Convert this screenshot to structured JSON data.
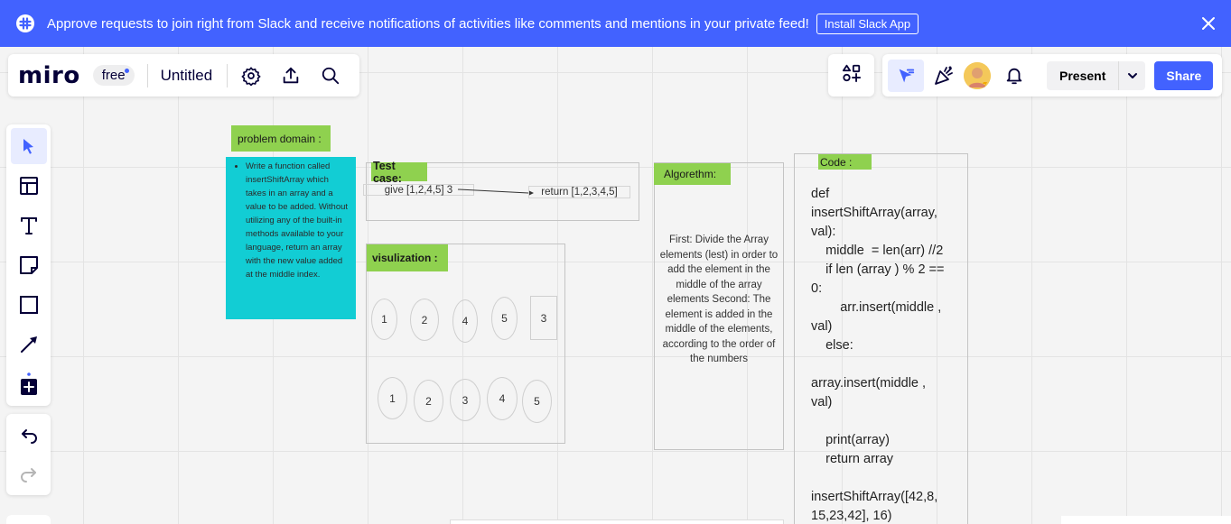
{
  "banner": {
    "message": "Approve requests to join right from Slack and receive notifications of activities like comments and mentions in your private feed!",
    "install_label": "Install Slack App",
    "bg_color": "#4262ff"
  },
  "header": {
    "logo": "miro",
    "plan": "free",
    "board_title": "Untitled"
  },
  "toolbar_right": {
    "present_label": "Present",
    "share_label": "Share",
    "accent": "#4262ff"
  },
  "board": {
    "problem_domain_title": "problem domain :",
    "problem_domain_text": "Write a function called insertShiftArray which takes in an array and a value to be added. Without utilizing any of the built-in methods available to your language, return an array with the new value added at the middle index.",
    "test_case_title": "Test case:",
    "test_input": "give [1,2,4,5] 3",
    "test_output": "return [1,2,3,4,5]",
    "visualization_title": "visulization :",
    "before_items": [
      "1",
      "2",
      "4",
      "5"
    ],
    "inserted_value": "3",
    "after_items": [
      "1",
      "2",
      "3",
      "4",
      "5"
    ],
    "algorithm_title": "Algorethm:",
    "algorithm_text": "First: Divide the Array elements (lest) in order to add the element in the middle of the array elements Second: The element is added in the middle of the elements, according to the order of the numbers",
    "code_title": "Code :",
    "code_text": "def\ninsertShiftArray(array,\nval):\n    middle  = len(arr) //2\n    if len (array ) % 2 ==\n0:\n        arr.insert(middle ,\nval)\n    else:\n\narray.insert(middle ,\nval)\n\n    print(array)\n    return array\n\ninsertShiftArray([42,8,\n15,23,42], 16)",
    "sticky_color": "#12cdd4",
    "label_color": "#8fd14f"
  }
}
